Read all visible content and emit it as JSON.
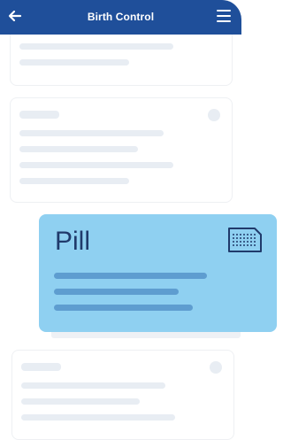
{
  "header": {
    "title": "Birth Control",
    "back_icon": "arrow-left-icon",
    "menu_icon": "hamburger-menu-icon"
  },
  "selected_card": {
    "title": "Pill",
    "icon": "pill-pack-icon"
  },
  "colors": {
    "header_bg": "#1f4f9a",
    "selected_card_bg": "#8fd0f1",
    "selected_text": "#203a6b",
    "placeholder": "#e8edf3"
  }
}
